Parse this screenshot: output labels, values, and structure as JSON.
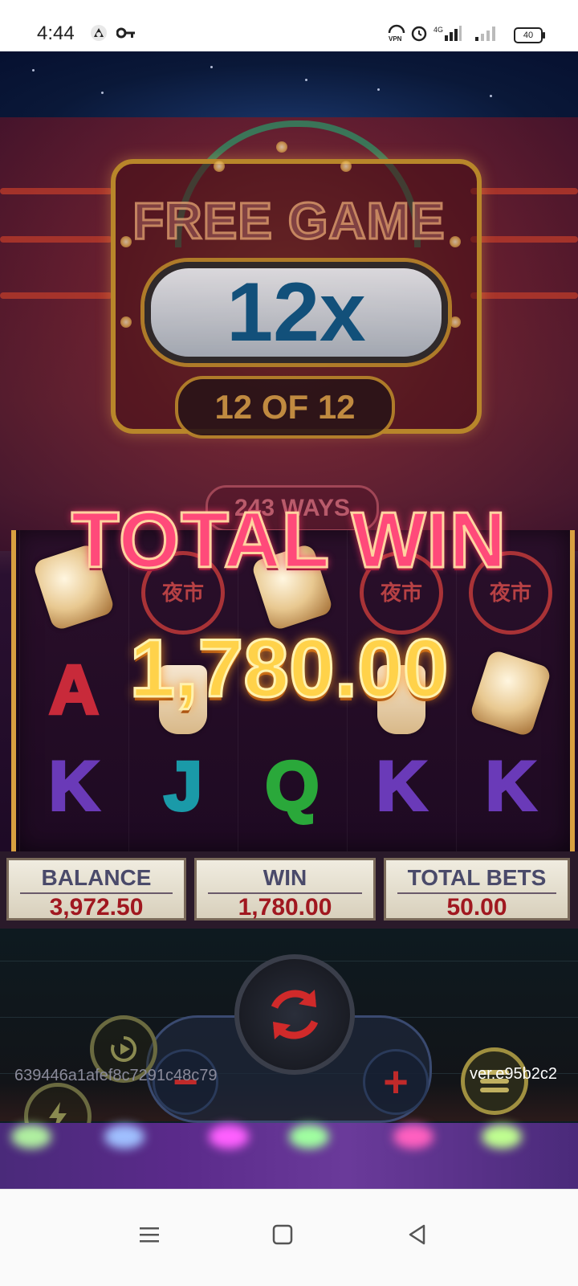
{
  "status_bar": {
    "time": "4:44",
    "icons": [
      "notification-icon",
      "key-icon",
      "vpn-icon",
      "alarm-icon",
      "signal-4g-icon",
      "signal-icon"
    ],
    "battery": "40"
  },
  "marquee": {
    "title": "FREE GAME",
    "multiplier": "12x",
    "spins_count": "12 OF 12"
  },
  "reels": {
    "ways_label": "243 WAYS",
    "sign_text": "夜市",
    "letters": [
      "A",
      "K",
      "J",
      "Q",
      "K",
      "K",
      "J"
    ]
  },
  "win_overlay": {
    "title": "TOTAL WIN",
    "amount": "1,780.00"
  },
  "info_bar": {
    "balance_label": "BALANCE",
    "balance_value": "3,972.50",
    "win_label": "WIN",
    "win_value": "1,780.00",
    "total_bets_label": "TOTAL BETS",
    "total_bets_value": "50.00"
  },
  "controls": {
    "spin_icon": "refresh-icon",
    "minus_symbol": "−",
    "plus_symbol": "+",
    "menu_icon": "menu-icon",
    "auto_icon": "autoplay-icon",
    "turbo_icon": "lightning-icon"
  },
  "footer": {
    "game_id": "639446a1afef8c7291c48c79",
    "version": "ver.e95b2c2"
  },
  "colors": {
    "total_win": "#ff4a7a",
    "win_amount": "#ffd24a",
    "info_value": "#a01820",
    "multiplier": "#12507a"
  }
}
